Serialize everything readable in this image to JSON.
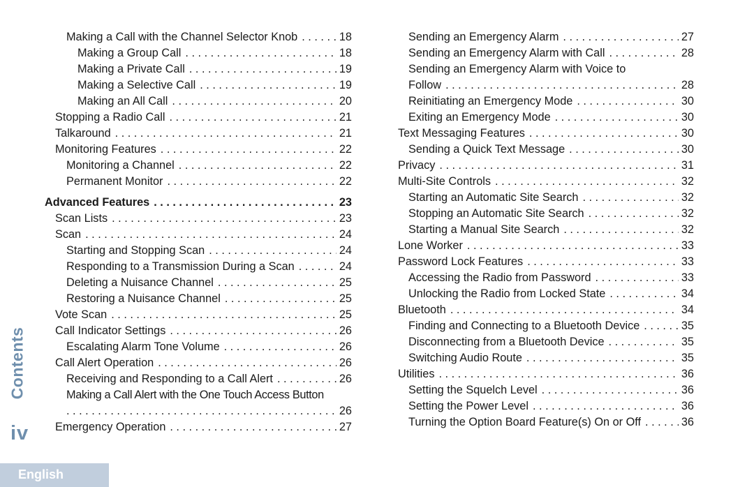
{
  "side_label": "Contents",
  "page_number": "iv",
  "language_tab": "English",
  "colors": {
    "accent": "#6f8fad",
    "tab_background": "#c1cedd",
    "text": "#1a1a1a"
  },
  "toc": {
    "left_column": [
      {
        "title": "Making a Call with the Channel Selector Knob",
        "page": "18",
        "level": 2
      },
      {
        "title": "Making a Group Call",
        "page": "18",
        "level": 3
      },
      {
        "title": "Making a Private Call",
        "page": "19",
        "level": 3
      },
      {
        "title": "Making a Selective Call",
        "page": "19",
        "level": 3
      },
      {
        "title": "Making an All Call",
        "page": "20",
        "level": 3
      },
      {
        "title": "Stopping a Radio Call",
        "page": "21",
        "level": 1
      },
      {
        "title": "Talkaround",
        "page": "21",
        "level": 1
      },
      {
        "title": "Monitoring Features",
        "page": "22",
        "level": 1
      },
      {
        "title": "Monitoring a Channel",
        "page": "22",
        "level": 2
      },
      {
        "title": "Permanent Monitor",
        "page": "22",
        "level": 2
      },
      {
        "title": "Advanced Features",
        "page": "23",
        "level": 0
      },
      {
        "title": "Scan Lists",
        "page": "23",
        "level": 1
      },
      {
        "title": "Scan",
        "page": "24",
        "level": 1
      },
      {
        "title": "Starting and Stopping Scan",
        "page": "24",
        "level": 2
      },
      {
        "title": "Responding to a Transmission During a Scan",
        "page": "24",
        "level": 2
      },
      {
        "title": "Deleting a Nuisance Channel",
        "page": "25",
        "level": 2
      },
      {
        "title": "Restoring a Nuisance Channel",
        "page": "25",
        "level": 2
      },
      {
        "title": "Vote Scan",
        "page": "25",
        "level": 1
      },
      {
        "title": "Call Indicator Settings",
        "page": "26",
        "level": 1
      },
      {
        "title": "Escalating Alarm Tone Volume",
        "page": "26",
        "level": 2
      },
      {
        "title": "Call Alert Operation",
        "page": "26",
        "level": 1
      },
      {
        "title": "Receiving and Responding to a Call Alert",
        "page": "26",
        "level": 2
      },
      {
        "title": "Making a Call Alert with the One Touch Access Button",
        "page": "26",
        "level": 2,
        "wrapped": true
      },
      {
        "title": "Emergency Operation",
        "page": "27",
        "level": 1
      }
    ],
    "right_column": [
      {
        "title": "Sending an Emergency Alarm",
        "page": "27",
        "level": 2
      },
      {
        "title": "Sending an Emergency Alarm with Call",
        "page": "28",
        "level": 2
      },
      {
        "title": "Sending an Emergency Alarm with Voice to",
        "continuation": "Follow",
        "page": "28",
        "level": 2,
        "wrapped": true
      },
      {
        "title": "Reinitiating an Emergency Mode",
        "page": "30",
        "level": 2
      },
      {
        "title": "Exiting an Emergency Mode",
        "page": "30",
        "level": 2
      },
      {
        "title": "Text Messaging Features",
        "page": "30",
        "level": 1
      },
      {
        "title": "Sending a Quick Text Message",
        "page": "30",
        "level": 2
      },
      {
        "title": "Privacy",
        "page": "31",
        "level": 1
      },
      {
        "title": "Multi-Site Controls",
        "page": "32",
        "level": 1
      },
      {
        "title": "Starting an Automatic Site Search",
        "page": "32",
        "level": 2
      },
      {
        "title": "Stopping an Automatic Site Search",
        "page": "32",
        "level": 2
      },
      {
        "title": "Starting a Manual Site Search",
        "page": "32",
        "level": 2
      },
      {
        "title": "Lone Worker",
        "page": "33",
        "level": 1
      },
      {
        "title": "Password Lock Features",
        "page": "33",
        "level": 1
      },
      {
        "title": "Accessing the Radio from Password",
        "page": "33",
        "level": 2
      },
      {
        "title": "Unlocking the Radio from Locked State",
        "page": "34",
        "level": 2
      },
      {
        "title": "Bluetooth",
        "page": "34",
        "level": 1
      },
      {
        "title": "Finding and Connecting to a Bluetooth Device",
        "page": "35",
        "level": 2
      },
      {
        "title": "Disconnecting from a Bluetooth Device",
        "page": "35",
        "level": 2
      },
      {
        "title": "Switching Audio Route",
        "page": "35",
        "level": 2
      },
      {
        "title": "Utilities",
        "page": "36",
        "level": 1
      },
      {
        "title": "Setting the Squelch Level",
        "page": "36",
        "level": 2
      },
      {
        "title": "Setting the Power Level",
        "page": "36",
        "level": 2
      },
      {
        "title": "Turning the Option Board Feature(s) On or Off",
        "page": "36",
        "level": 2
      }
    ]
  }
}
